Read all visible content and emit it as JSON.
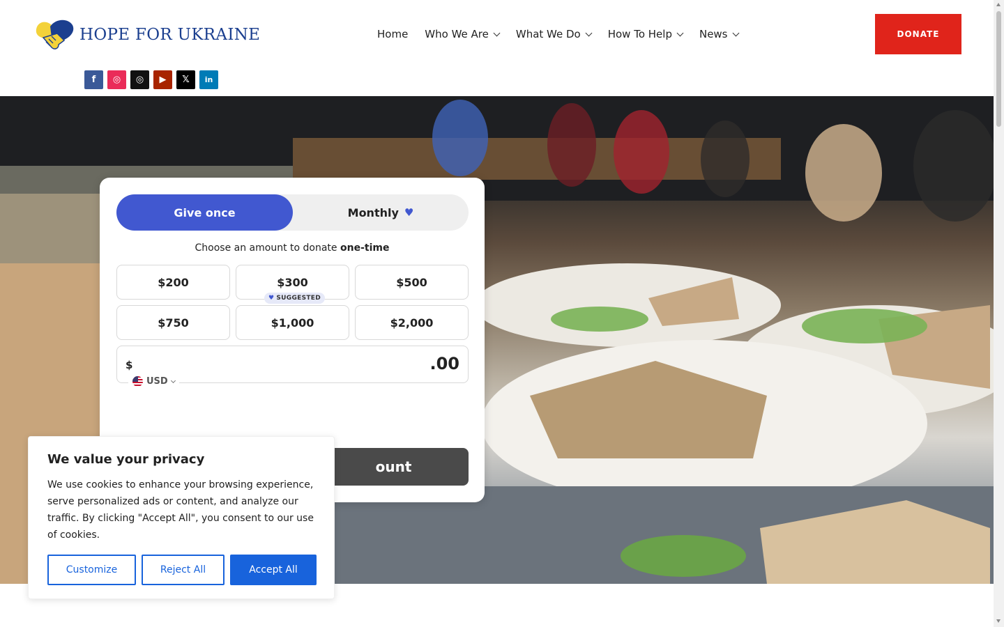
{
  "brand": {
    "name": "HOPE FOR UKRAINE",
    "colors": {
      "blue": "#1b3f8f",
      "yellow": "#f3d23a",
      "red": "#e0241b"
    }
  },
  "nav": {
    "items": [
      {
        "label": "Home",
        "dropdown": false
      },
      {
        "label": "Who We Are",
        "dropdown": true
      },
      {
        "label": "What We Do",
        "dropdown": true
      },
      {
        "label": "How To Help",
        "dropdown": true
      },
      {
        "label": "News",
        "dropdown": true
      }
    ],
    "donate_label": "DONATE"
  },
  "social": {
    "icons": [
      {
        "name": "facebook-icon",
        "glyph": "f"
      },
      {
        "name": "instagram-icon",
        "glyph": "◎"
      },
      {
        "name": "instagram-alt-icon",
        "glyph": "◎"
      },
      {
        "name": "youtube-icon",
        "glyph": "▶"
      },
      {
        "name": "x-icon",
        "glyph": "𝕏"
      },
      {
        "name": "linkedin-icon",
        "glyph": "in"
      }
    ]
  },
  "donation": {
    "tabs": {
      "once": "Give once",
      "monthly": "Monthly"
    },
    "prompt_prefix": "Choose an amount to donate",
    "prompt_bold": "one-time",
    "amounts": [
      "$200",
      "$300",
      "$500",
      "$750",
      "$1,000",
      "$2,000"
    ],
    "suggested_label": "SUGGESTED",
    "currency_symbol": "$",
    "amount_value": ".00",
    "currency_code": "USD",
    "cta_label": "ount",
    "accent": "#4158d0"
  },
  "cookie": {
    "title": "We value your privacy",
    "text": "We use cookies to enhance your browsing experience, serve personalized ads or content, and analyze our traffic. By clicking \"Accept All\", you consent to our use of cookies.",
    "customize": "Customize",
    "reject": "Reject All",
    "accept": "Accept All",
    "accent": "#1863dc"
  }
}
